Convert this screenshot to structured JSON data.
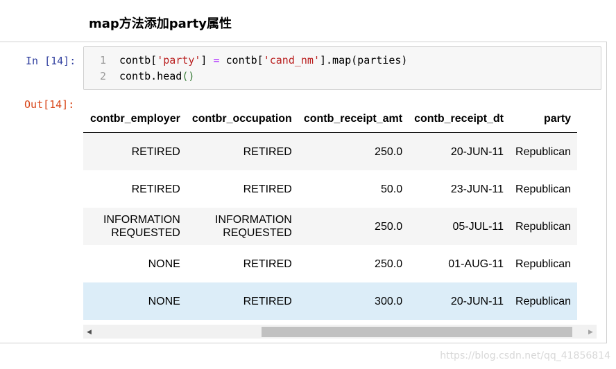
{
  "heading": "map方法添加party属性",
  "cell": {
    "in_prompt": "In [14]:",
    "out_prompt": "Out[14]:",
    "code_lines": [
      {
        "number": "1",
        "tokens": [
          {
            "text": "contb[",
            "type": "plain"
          },
          {
            "text": "'party'",
            "type": "str"
          },
          {
            "text": "] ",
            "type": "plain"
          },
          {
            "text": "=",
            "type": "op"
          },
          {
            "text": " contb[",
            "type": "plain"
          },
          {
            "text": "'cand_nm'",
            "type": "str"
          },
          {
            "text": "].map(parties)",
            "type": "plain"
          }
        ]
      },
      {
        "number": "2",
        "tokens": [
          {
            "text": "contb.head",
            "type": "plain"
          },
          {
            "text": "()",
            "type": "paren"
          }
        ]
      }
    ]
  },
  "dataframe": {
    "columns": [
      "contbr_employer",
      "contbr_occupation",
      "contb_receipt_amt",
      "contb_receipt_dt",
      "party"
    ],
    "rows": [
      [
        "RETIRED",
        "RETIRED",
        "250.0",
        "20-JUN-11",
        "Republican"
      ],
      [
        "RETIRED",
        "RETIRED",
        "50.0",
        "23-JUN-11",
        "Republican"
      ],
      [
        "INFORMATION\nREQUESTED",
        "INFORMATION\nREQUESTED",
        "250.0",
        "05-JUL-11",
        "Republican"
      ],
      [
        "NONE",
        "RETIRED",
        "250.0",
        "01-AUG-11",
        "Republican"
      ],
      [
        "NONE",
        "RETIRED",
        "300.0",
        "20-JUN-11",
        "Republican"
      ]
    ],
    "hovered_row": 4
  },
  "scrollbar": {
    "left_arrow_icon": "triangle-left-icon",
    "right_arrow_icon": "triangle-right-icon",
    "thumb_start": 0.34,
    "thumb_end": 0.975
  },
  "watermark": "https://blog.csdn.net/qq_41856814",
  "colors": {
    "in_prompt": "#303f9f",
    "out_prompt": "#d84315",
    "string": "#ba2121",
    "operator": "#aa22ff",
    "hover_row": "#dcedf8"
  }
}
